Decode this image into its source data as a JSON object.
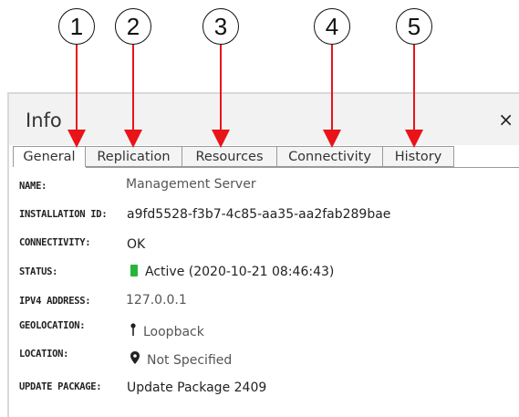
{
  "callouts": [
    "1",
    "2",
    "3",
    "4",
    "5"
  ],
  "panel": {
    "title": "Info",
    "close_glyph": "×",
    "tabs": [
      "General",
      "Replication",
      "Resources",
      "Connectivity",
      "History"
    ],
    "active_tab": "General"
  },
  "fields": [
    {
      "label": "NAME:",
      "value": "Management Server"
    },
    {
      "label": "INSTALLATION ID:",
      "value": "a9fd5528-f3b7-4c85-aa35-aa2fab289bae"
    },
    {
      "label": "CONNECTIVITY:",
      "value": "OK"
    },
    {
      "label": "STATUS:",
      "value": "Active (2020-10-21 08:46:43)"
    },
    {
      "label": "IPV4 ADDRESS:",
      "value": "127.0.0.1"
    },
    {
      "label": "GEOLOCATION:",
      "value": "Loopback"
    },
    {
      "label": "LOCATION:",
      "value": "Not Specified"
    },
    {
      "label": "UPDATE PACKAGE:",
      "value": "Update Package 2409"
    }
  ],
  "icons": {
    "status": "status-active-icon",
    "geolocation": "pin-icon",
    "location": "map-marker-icon",
    "close": "close-icon"
  },
  "colors": {
    "callout_arrow": "#e8141a",
    "status_active": "#27b53b",
    "header_bg": "#f2f2f2"
  }
}
